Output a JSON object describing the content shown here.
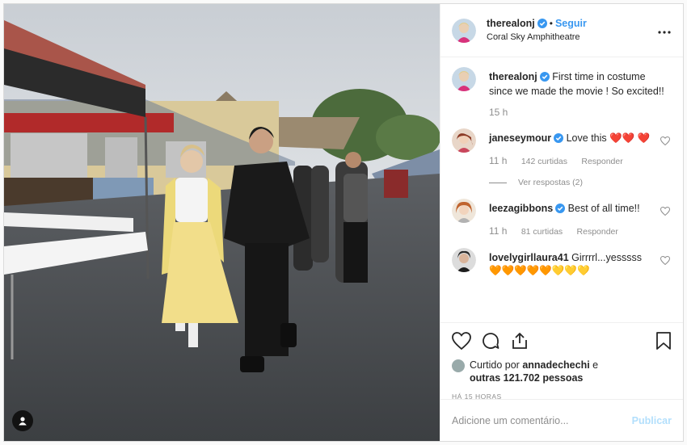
{
  "post": {
    "photo_description_icon": "user-tag-icon",
    "photo_banner": "SEASONBEATS",
    "photo_signs": [
      "WAITSTAFF ONLY",
      "FANTASTICKETS",
      "CONCESSIONS"
    ]
  },
  "header": {
    "username": "therealonj",
    "separator": "•",
    "follow_label": "Seguir",
    "location": "Coral Sky Amphitheatre",
    "more_icon": "more-options-icon"
  },
  "caption": {
    "username": "therealonj",
    "text": "First time in costume since we made the movie ! So excited!!",
    "time": "15 h"
  },
  "comments": [
    {
      "username": "janeseymour",
      "text": "Love this ❤️❤️ ❤️",
      "time": "11 h",
      "likes": "142 curtidas",
      "reply": "Responder",
      "view_replies": "Ver respostas (2)"
    },
    {
      "username": "leezagibbons",
      "text": "Best of all time!!",
      "time": "11 h",
      "likes": "81 curtidas",
      "reply": "Responder"
    },
    {
      "username": "lovelygirllaura41",
      "text": "Girrrrl...yesssss",
      "emoji": "🧡🧡🧡🧡🧡💛💛💛"
    }
  ],
  "actions": {
    "like_icon": "heart-icon",
    "comment_icon": "comment-icon",
    "share_icon": "share-icon",
    "save_icon": "bookmark-icon",
    "liked_by_prefix": "Curtido por ",
    "liked_by_user": "annadechechi",
    "liked_by_suffix": " e",
    "liked_by_others": "outras 121.702 pessoas",
    "timestamp": "HÁ 15 HORAS"
  },
  "add_comment": {
    "placeholder": "Adicione um comentário...",
    "publish_label": "Publicar"
  },
  "colors": {
    "link_blue": "#3897f0",
    "publish_disabled": "#b2dffc",
    "verified": "#3897f0"
  }
}
